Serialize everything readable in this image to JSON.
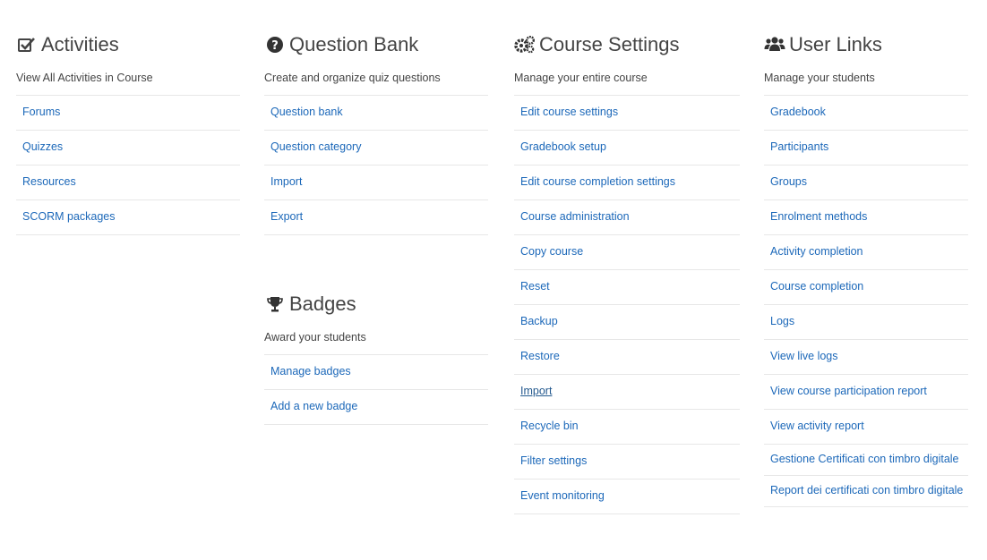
{
  "activities": {
    "title": "Activities",
    "icon": "checkbox-icon",
    "subtitle": "View All Activities in Course",
    "links": [
      "Forums",
      "Quizzes",
      "Resources",
      "SCORM packages"
    ]
  },
  "question_bank": {
    "title": "Question Bank",
    "icon": "question-circle-icon",
    "subtitle": "Create and organize quiz questions",
    "links": [
      "Question bank",
      "Question category",
      "Import",
      "Export"
    ]
  },
  "badges": {
    "title": "Badges",
    "icon": "trophy-icon",
    "subtitle": "Award your students",
    "links": [
      "Manage badges",
      "Add a new badge"
    ]
  },
  "course_settings": {
    "title": "Course Settings",
    "icon": "cogs-icon",
    "subtitle": "Manage your entire course",
    "links": [
      "Edit course settings",
      "Gradebook setup",
      "Edit course completion settings",
      "Course administration",
      "Copy course",
      "Reset",
      "Backup",
      "Restore",
      "Import",
      "Recycle bin",
      "Filter settings",
      "Event monitoring"
    ]
  },
  "user_links": {
    "title": "User Links",
    "icon": "users-icon",
    "subtitle": "Manage your students",
    "links": [
      "Gradebook",
      "Participants",
      "Groups",
      "Enrolment methods",
      "Activity completion",
      "Course completion",
      "Logs",
      "View live logs",
      "View course participation report",
      "View activity report",
      "Gestione Certificati con timbro digitale",
      "Report dei certificati con timbro digitale"
    ]
  },
  "colors": {
    "link": "#1c68b9",
    "heading": "#444444",
    "divider": "#e7e7e7"
  }
}
